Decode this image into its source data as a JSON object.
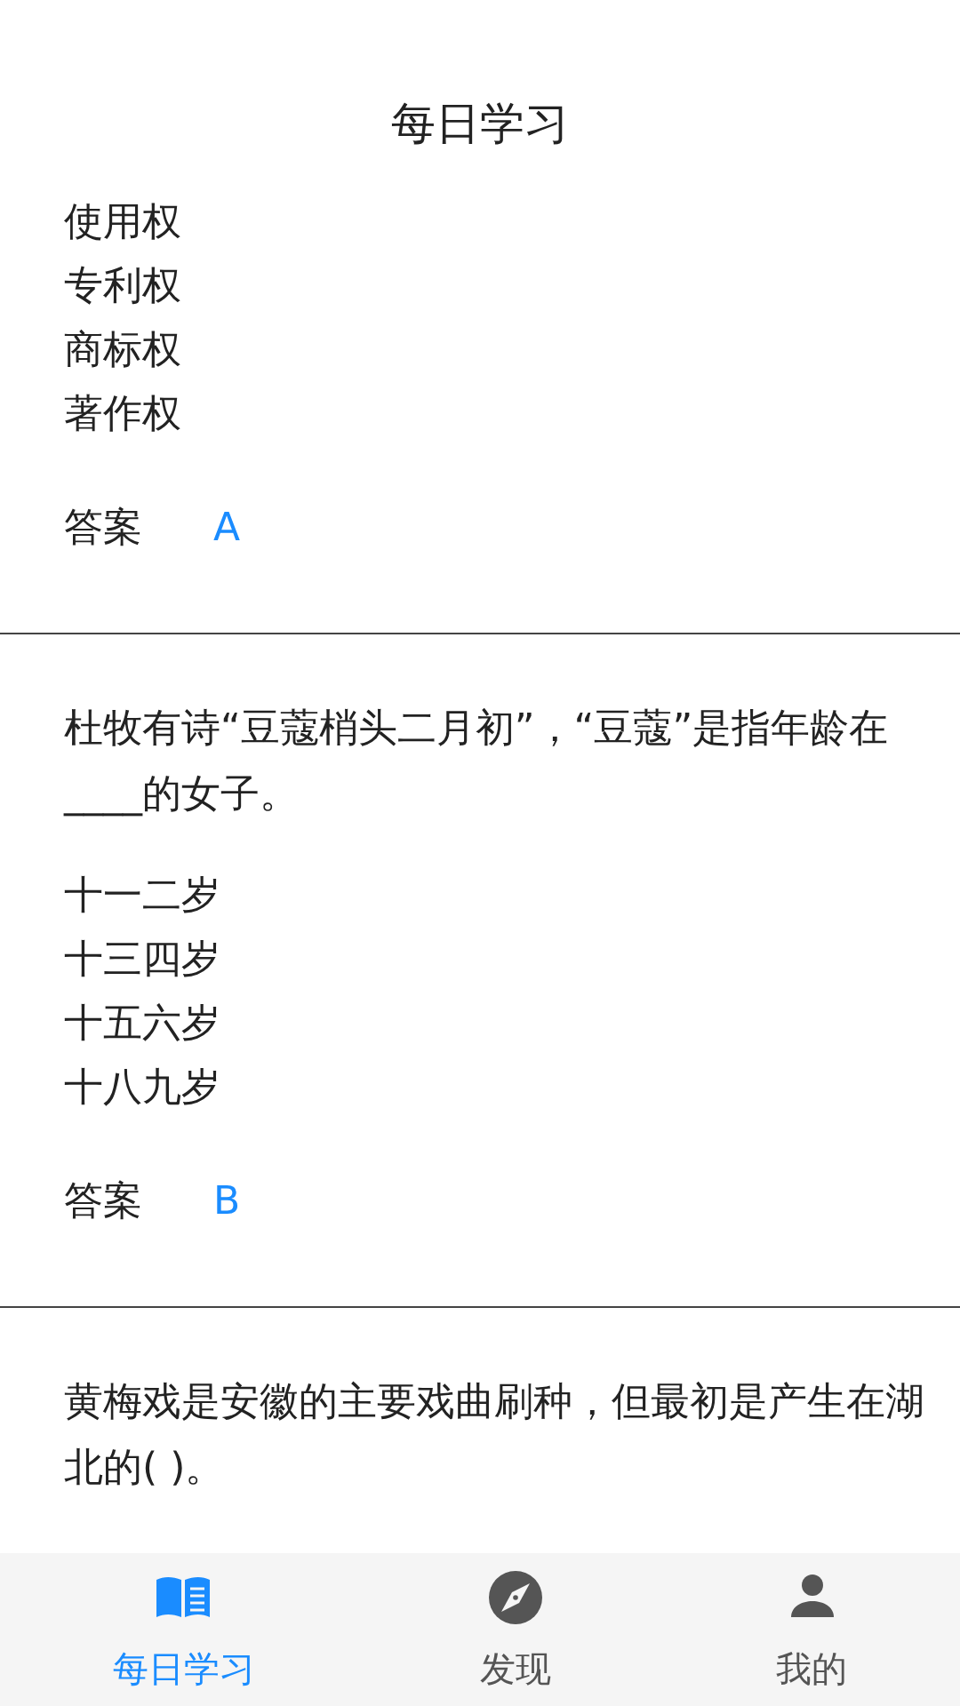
{
  "header": {
    "title": "每日学习"
  },
  "questions": [
    {
      "options": [
        "使用权",
        "专利权",
        "商标权",
        "著作权"
      ],
      "answer_label": "答案",
      "answer": "A"
    },
    {
      "question": "杜牧有诗“豆蔻梢头二月初”，“豆蔻”是指年龄在____的女子。",
      "options": [
        "十一二岁",
        "十三四岁",
        "十五六岁",
        "十八九岁"
      ],
      "answer_label": "答案",
      "answer": "B"
    },
    {
      "question": "黄梅戏是安徽的主要戏曲刷种，但最初是产生在湖北的( )。"
    }
  ],
  "tab_bar": [
    {
      "label": "每日学习",
      "kind": "book",
      "selected": true
    },
    {
      "label": "发现",
      "kind": "compass",
      "selected": false
    },
    {
      "label": "我的",
      "kind": "person",
      "selected": false
    }
  ]
}
